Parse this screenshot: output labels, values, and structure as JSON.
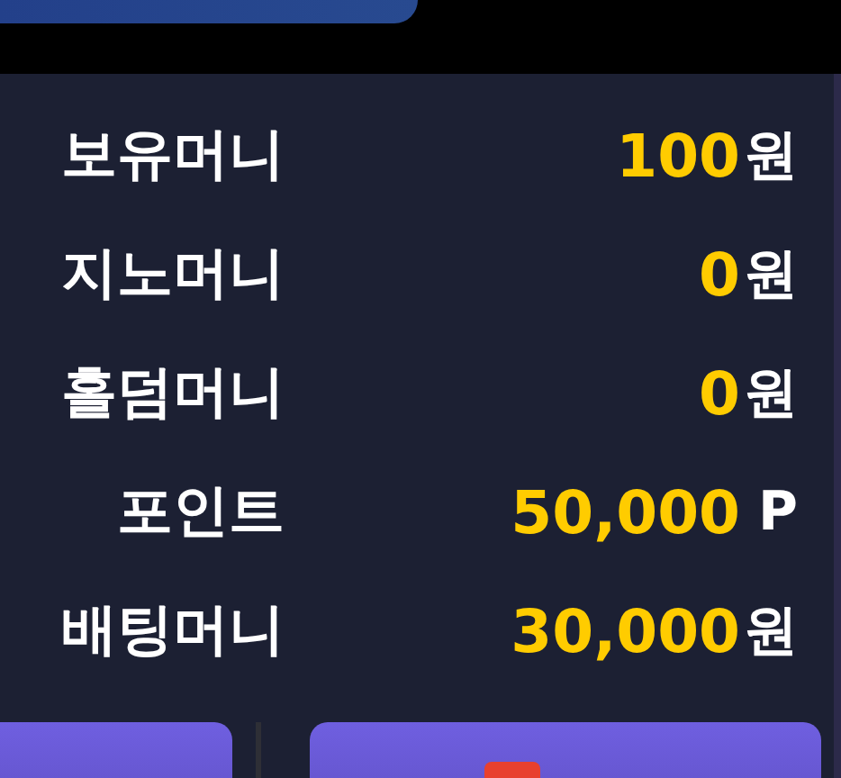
{
  "rows": [
    {
      "label": "보유머니",
      "value": "100",
      "unit": "원"
    },
    {
      "label": "지노머니",
      "value": "0",
      "unit": "원"
    },
    {
      "label": "홀덤머니",
      "value": "0",
      "unit": "원"
    },
    {
      "label": "포인트",
      "value": "50,000",
      "unit": "P"
    },
    {
      "label": "배팅머니",
      "value": "30,000",
      "unit": "원"
    }
  ],
  "buttons": [
    {
      "kind": "plain"
    },
    {
      "kind": "iconed"
    }
  ]
}
